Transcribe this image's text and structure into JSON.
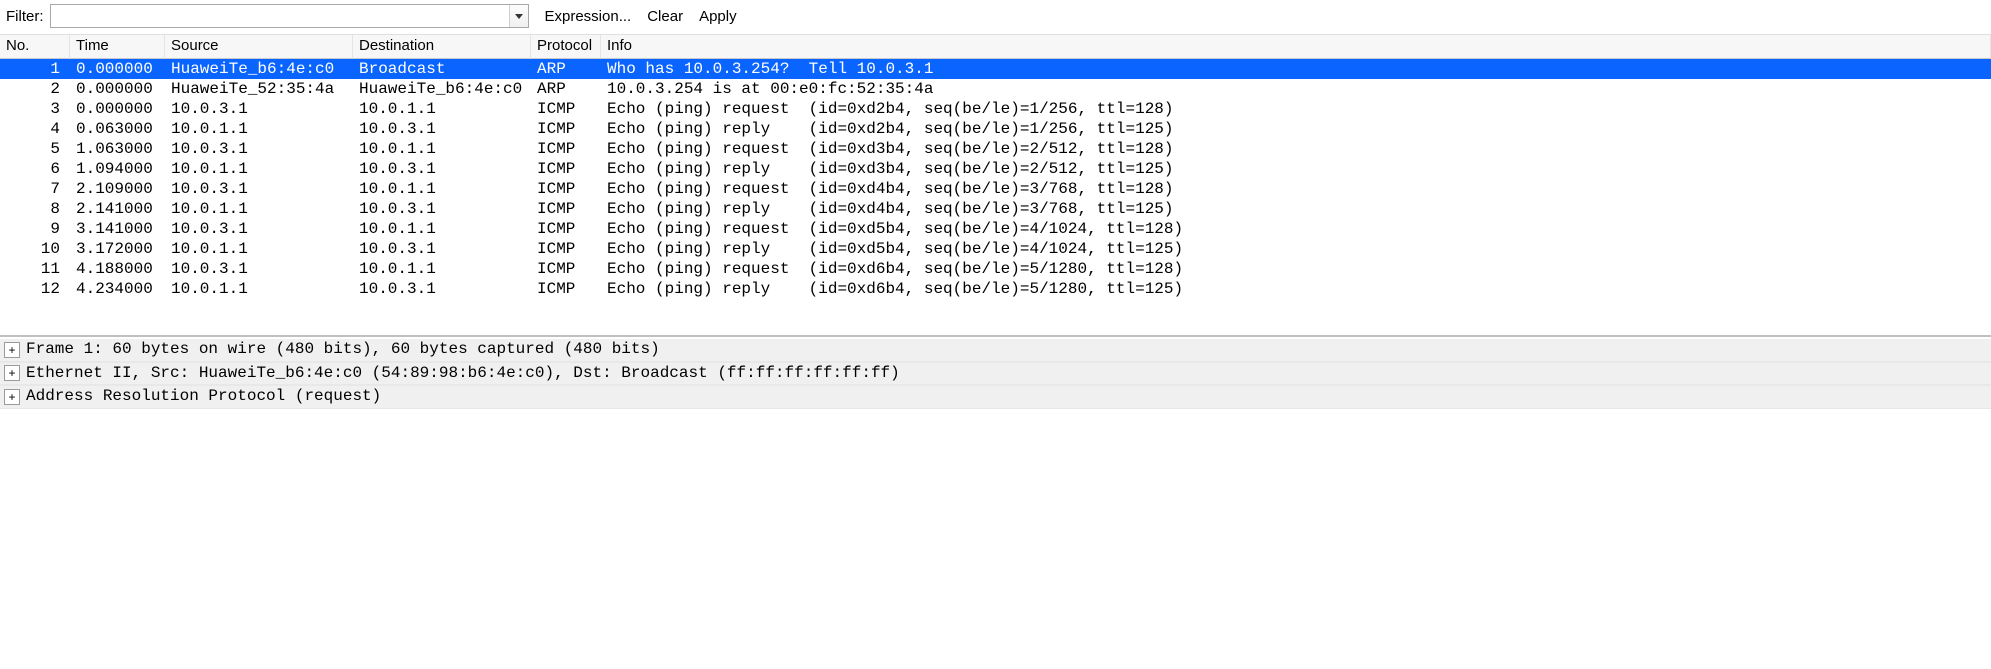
{
  "toolbar": {
    "filter_label": "Filter:",
    "filter_value": "",
    "expression_label": "Expression...",
    "clear_label": "Clear",
    "apply_label": "Apply"
  },
  "columns": {
    "no": "No.",
    "time": "Time",
    "source": "Source",
    "destination": "Destination",
    "protocol": "Protocol",
    "info": "Info"
  },
  "packets": [
    {
      "no": "1",
      "time": "0.000000",
      "source": "HuaweiTe_b6:4e:c0",
      "destination": "Broadcast",
      "protocol": "ARP",
      "info": "Who has 10.0.3.254?  Tell 10.0.3.1",
      "selected": true
    },
    {
      "no": "2",
      "time": "0.000000",
      "source": "HuaweiTe_52:35:4a",
      "destination": "HuaweiTe_b6:4e:c0",
      "protocol": "ARP",
      "info": "10.0.3.254 is at 00:e0:fc:52:35:4a"
    },
    {
      "no": "3",
      "time": "0.000000",
      "source": "10.0.3.1",
      "destination": "10.0.1.1",
      "protocol": "ICMP",
      "info": "Echo (ping) request  (id=0xd2b4, seq(be/le)=1/256, ttl=128)"
    },
    {
      "no": "4",
      "time": "0.063000",
      "source": "10.0.1.1",
      "destination": "10.0.3.1",
      "protocol": "ICMP",
      "info": "Echo (ping) reply    (id=0xd2b4, seq(be/le)=1/256, ttl=125)"
    },
    {
      "no": "5",
      "time": "1.063000",
      "source": "10.0.3.1",
      "destination": "10.0.1.1",
      "protocol": "ICMP",
      "info": "Echo (ping) request  (id=0xd3b4, seq(be/le)=2/512, ttl=128)"
    },
    {
      "no": "6",
      "time": "1.094000",
      "source": "10.0.1.1",
      "destination": "10.0.3.1",
      "protocol": "ICMP",
      "info": "Echo (ping) reply    (id=0xd3b4, seq(be/le)=2/512, ttl=125)"
    },
    {
      "no": "7",
      "time": "2.109000",
      "source": "10.0.3.1",
      "destination": "10.0.1.1",
      "protocol": "ICMP",
      "info": "Echo (ping) request  (id=0xd4b4, seq(be/le)=3/768, ttl=128)"
    },
    {
      "no": "8",
      "time": "2.141000",
      "source": "10.0.1.1",
      "destination": "10.0.3.1",
      "protocol": "ICMP",
      "info": "Echo (ping) reply    (id=0xd4b4, seq(be/le)=3/768, ttl=125)"
    },
    {
      "no": "9",
      "time": "3.141000",
      "source": "10.0.3.1",
      "destination": "10.0.1.1",
      "protocol": "ICMP",
      "info": "Echo (ping) request  (id=0xd5b4, seq(be/le)=4/1024, ttl=128)"
    },
    {
      "no": "10",
      "time": "3.172000",
      "source": "10.0.1.1",
      "destination": "10.0.3.1",
      "protocol": "ICMP",
      "info": "Echo (ping) reply    (id=0xd5b4, seq(be/le)=4/1024, ttl=125)"
    },
    {
      "no": "11",
      "time": "4.188000",
      "source": "10.0.3.1",
      "destination": "10.0.1.1",
      "protocol": "ICMP",
      "info": "Echo (ping) request  (id=0xd6b4, seq(be/le)=5/1280, ttl=128)"
    },
    {
      "no": "12",
      "time": "4.234000",
      "source": "10.0.1.1",
      "destination": "10.0.3.1",
      "protocol": "ICMP",
      "info": "Echo (ping) reply    (id=0xd6b4, seq(be/le)=5/1280, ttl=125)"
    }
  ],
  "details": [
    "Frame 1: 60 bytes on wire (480 bits), 60 bytes captured (480 bits)",
    "Ethernet II, Src: HuaweiTe_b6:4e:c0 (54:89:98:b6:4e:c0), Dst: Broadcast (ff:ff:ff:ff:ff:ff)",
    "Address Resolution Protocol (request)"
  ]
}
